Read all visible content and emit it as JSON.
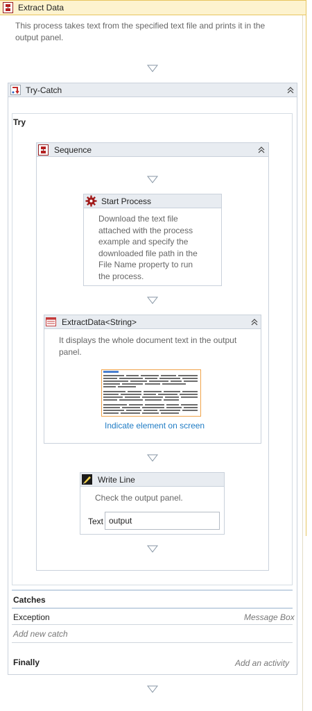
{
  "extract_data": {
    "title": "Extract Data",
    "description": "This process takes text from the specified text file and prints it in the output panel."
  },
  "try_catch": {
    "title": "Try-Catch",
    "try_label": "Try",
    "catches_label": "Catches",
    "exception_type": "Exception",
    "exception_handler": "Message Box",
    "add_catch": "Add new catch",
    "finally_label": "Finally",
    "add_activity": "Add an activity"
  },
  "sequence": {
    "title": "Sequence"
  },
  "start_process": {
    "title": "Start Process",
    "description_lines": [
      "Download the text file",
      "attached with the process",
      "example and specify the",
      "downloaded file path in the",
      "File Name property to run",
      "the process."
    ]
  },
  "extract_data_activity": {
    "title": "ExtractData<String>",
    "description": "It displays the whole document text in the output panel.",
    "indicate_link": "Indicate element on screen"
  },
  "write_line": {
    "title": "Write Line",
    "description": "Check the output panel.",
    "text_label": "Text",
    "text_value": "output"
  },
  "icons": {
    "sequence": "sequence-icon",
    "try_catch": "try-catch-icon",
    "start_process": "gear-icon",
    "extract_data": "table-extract-icon",
    "write_line": "write-line-icon",
    "collapse": "double-chevron-up-icon",
    "drop": "drop-target-triangle-icon"
  },
  "colors": {
    "outer_header_bg": "#fdf3cf",
    "outer_header_border": "#e7c55f",
    "activity_header_bg": "#e8ecf1",
    "link": "#1e7bc4",
    "gear_red": "#a11b1b"
  }
}
